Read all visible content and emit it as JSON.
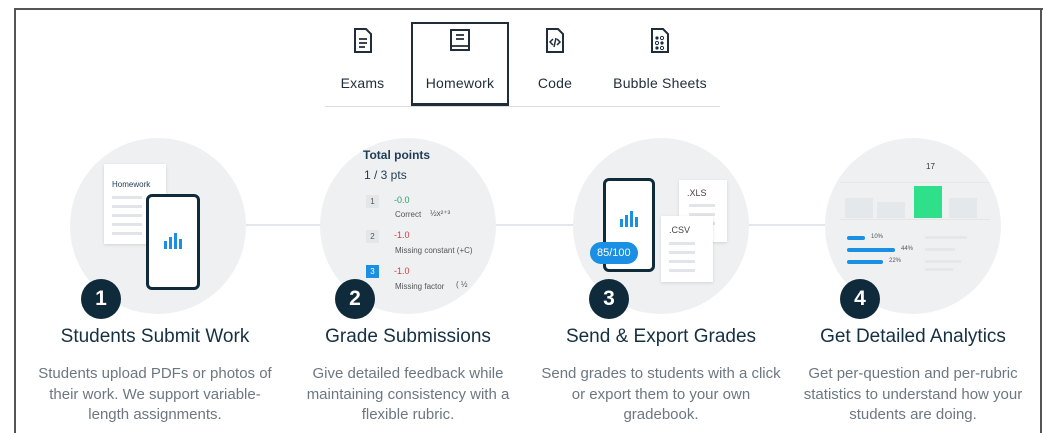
{
  "tabs": [
    {
      "label": "Exams",
      "icon": "exam-document-icon",
      "active": false
    },
    {
      "label": "Homework",
      "icon": "homework-book-icon",
      "active": true
    },
    {
      "label": "Code",
      "icon": "code-file-icon",
      "active": false
    },
    {
      "label": "Bubble Sheets",
      "icon": "bubble-sheet-icon",
      "active": false
    }
  ],
  "steps": [
    {
      "number": "1",
      "title": "Students Submit Work",
      "description": "Students upload PDFs or photos of their work. We support variable-length assignments.",
      "illustration": {
        "doc_label": "Homework"
      }
    },
    {
      "number": "2",
      "title": "Grade Submissions",
      "description": "Give detailed feedback while maintaining consistency with a flexible rubric.",
      "illustration": {
        "heading": "Total points",
        "score": "1 / 3 pts",
        "rubric": [
          {
            "index": "1",
            "value": "-0.0",
            "text": "Correct",
            "formula": "½x²⁺³",
            "selected": false,
            "color": "#2a9d6a"
          },
          {
            "index": "2",
            "value": "-1.0",
            "text": "Missing constant (+C)",
            "formula": "",
            "selected": false,
            "color": "#d83a3a"
          },
          {
            "index": "3",
            "value": "-1.0",
            "text": "Missing factor",
            "formula": "( ½",
            "selected": true,
            "color": "#d83a3a"
          }
        ]
      }
    },
    {
      "number": "3",
      "title": "Send & Export Grades",
      "description": "Send grades to students with a click or export them to your own gradebook.",
      "illustration": {
        "score_pill": "85/100",
        "file1": ".XLS",
        "file2": ".CSV"
      }
    },
    {
      "number": "4",
      "title": "Get Detailed Analytics",
      "description": "Get per-question and per-rubric statistics to understand how your students are doing.",
      "illustration": {
        "top_value": "17",
        "percents": [
          "10%",
          "44%",
          "22%"
        ]
      }
    }
  ],
  "colors": {
    "accent": "#1a8fe3",
    "dark": "#0f2a3a",
    "highlight": "#2ee08a"
  }
}
